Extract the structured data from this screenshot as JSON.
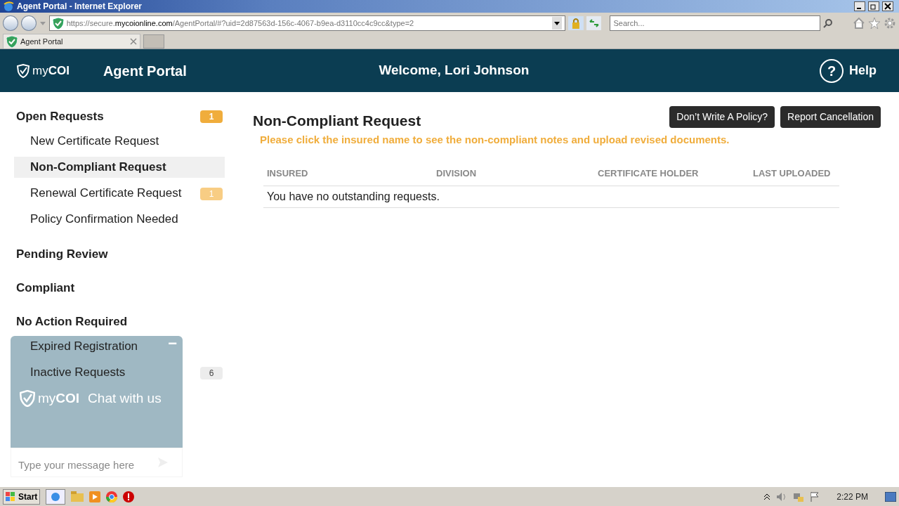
{
  "window": {
    "title": "Agent Portal - Internet Explorer"
  },
  "address_bar": {
    "url_prefix": "https://secure.",
    "url_domain": "mycoionline.com",
    "url_path": "/AgentPortal/#?uid=2d87563d-156c-4067-b9ea-d3110cc4c9cc&type=2"
  },
  "search": {
    "placeholder": "Search..."
  },
  "tabs": [
    {
      "label": "Agent Portal",
      "selected": true
    }
  ],
  "header": {
    "logo_text_light": "my",
    "logo_text_bold": "COI",
    "title": "Agent Portal",
    "welcome": "Welcome, Lori Johnson",
    "help_icon": "?",
    "help": "Help"
  },
  "sidebar": {
    "groups": [
      {
        "label": "Open Requests",
        "badge": "1",
        "color": "#f0ad3c",
        "children": [
          {
            "label": "New Certificate Request",
            "selected": false
          },
          {
            "label": "Non-Compliant Request",
            "selected": true
          },
          {
            "label": "Renewal Certificate Request",
            "selected": false,
            "badge": "1",
            "color": "#f8cd84"
          },
          {
            "label": "Policy Confirmation Needed",
            "selected": false
          }
        ]
      },
      {
        "label": "Pending Review"
      },
      {
        "label": "Compliant"
      },
      {
        "label": "No Action Required",
        "children": [
          {
            "label": "Expired Registration",
            "selected": false
          },
          {
            "label": "Inactive Requests",
            "selected": false,
            "badge": "6",
            "color": "#ececec"
          }
        ]
      }
    ]
  },
  "main": {
    "title": "Non-Compliant Request",
    "buttons": [
      "Don’t Write A Policy?",
      "Report Cancellation"
    ],
    "notice": "Please click the insured name to see the non-compliant notes and upload revised documents.",
    "table": {
      "columns": [
        "INSURED",
        "DIVISION",
        "CERTIFICATE HOLDER",
        "LAST UPLOADED"
      ],
      "empty_message": "You have no outstanding requests."
    }
  },
  "chat": {
    "minimize": "−",
    "logo_light": "my",
    "logo_bold": "COI",
    "title": "Chat with us",
    "placeholder": "Type your message here"
  },
  "taskbar": {
    "start": "Start",
    "time": "2:22 PM"
  }
}
